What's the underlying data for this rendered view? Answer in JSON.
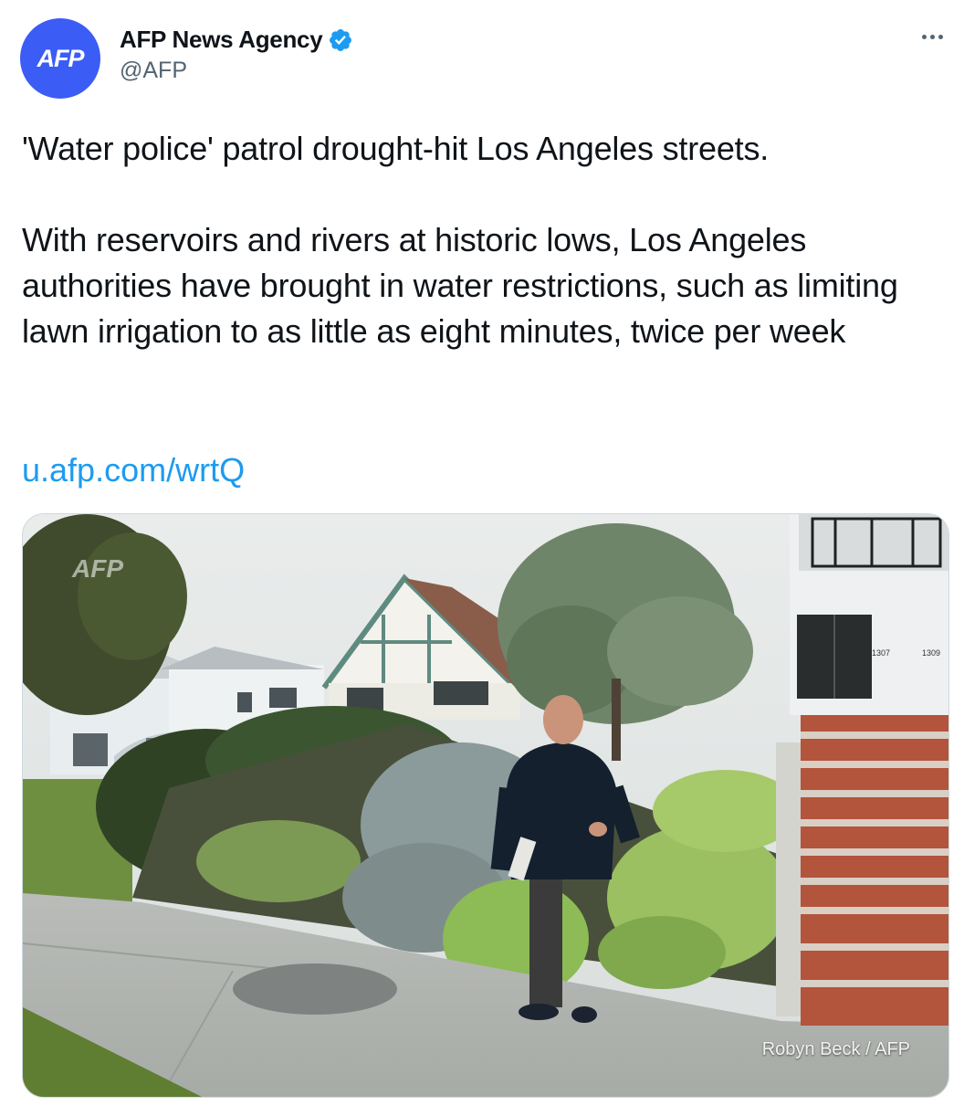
{
  "author": {
    "avatar_text": "AFP",
    "display_name": "AFP News Agency",
    "handle": "@AFP",
    "verified": true,
    "avatar_color": "#3b5cf5",
    "verified_color": "#1d9bf0"
  },
  "tweet": {
    "paragraph1": "'Water police' patrol drought-hit Los Angeles streets.",
    "paragraph2": "With reservoirs and rivers at historic lows, Los Angeles authorities have brought in water restrictions, such as limiting lawn irrigation to as little as eight minutes, twice per week",
    "link": "u.afp.com/wrtQ",
    "link_color": "#1d9bf0"
  },
  "media": {
    "watermark": "AFP",
    "photo_credit": "Robyn Beck / AFP",
    "house_numbers": [
      "1307",
      "1309"
    ]
  },
  "icons": {
    "verified": "verified-badge-icon",
    "more": "more-options-icon"
  }
}
